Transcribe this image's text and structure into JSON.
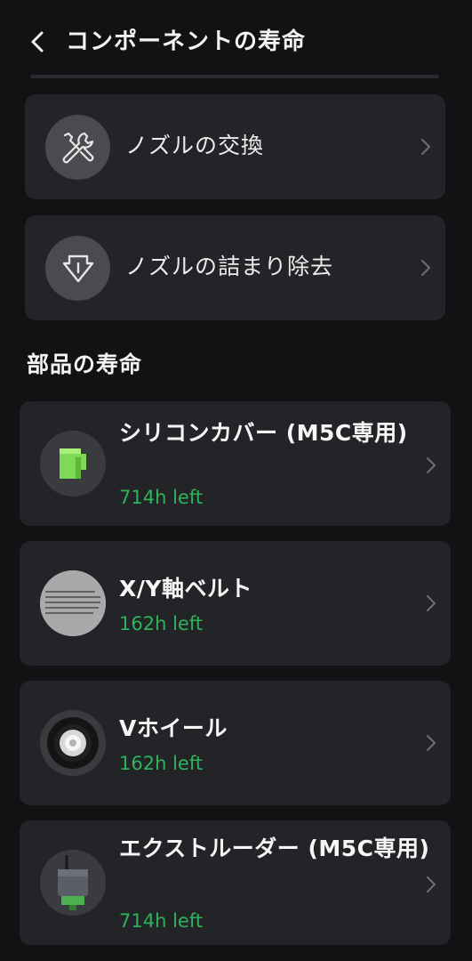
{
  "header": {
    "title": "コンポーネントの寿命"
  },
  "actions": [
    {
      "label": "ノズルの交換",
      "icon": "wrench-screwdriver-icon"
    },
    {
      "label": "ノズルの詰まり除去",
      "icon": "nozzle-clear-icon"
    }
  ],
  "section": {
    "title": "部品の寿命"
  },
  "parts": [
    {
      "name": "シリコンカバー (M5C専用)",
      "remaining": "714h left",
      "thumb": "silicone-cover"
    },
    {
      "name": "X/Y軸ベルト",
      "remaining": "162h left",
      "thumb": "belt"
    },
    {
      "name": "Vホイール",
      "remaining": "162h left",
      "thumb": "v-wheel"
    },
    {
      "name": "エクストルーダー (M5C専用)",
      "remaining": "714h left",
      "thumb": "extruder"
    }
  ],
  "colors": {
    "background": "#111214",
    "card": "#232427",
    "accent_green": "#2fb35a"
  }
}
